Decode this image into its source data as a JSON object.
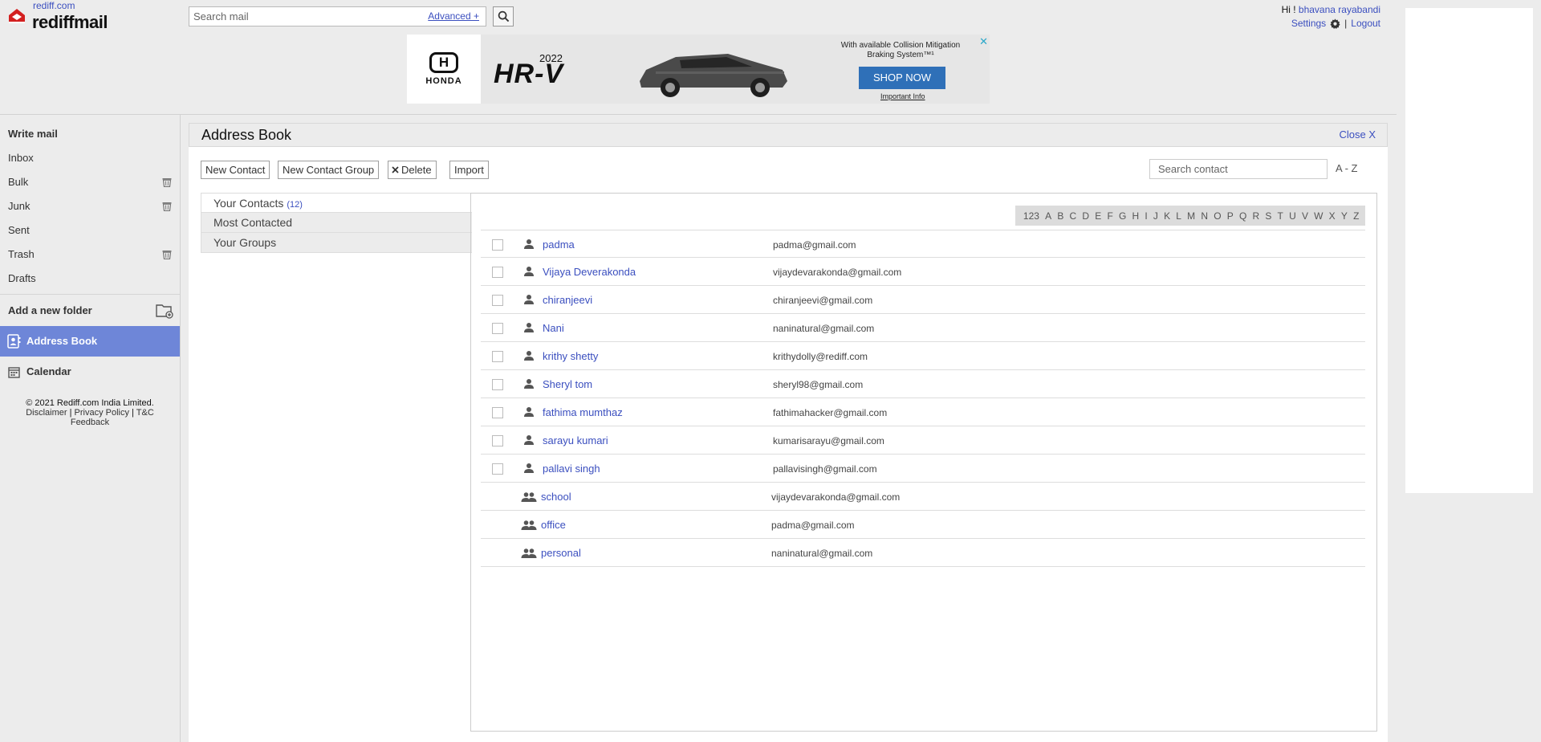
{
  "header": {
    "logo_small": "rediff.com",
    "logo_big": "rediffmail",
    "search_placeholder": "Search mail",
    "advanced_label": "Advanced +",
    "greeting": "Hi !",
    "user_name": "bhavana rayabandi",
    "settings_label": "Settings",
    "separator": "|",
    "logout_label": "Logout"
  },
  "ad": {
    "brand": "HONDA",
    "brand_mark": "H",
    "year": "2022",
    "model": "HR-V",
    "blurb": "With available Collision Mitigation Braking System™¹",
    "cta": "SHOP NOW",
    "info": "Important Info",
    "close": "✕"
  },
  "sidebar": {
    "write_mail": "Write mail",
    "folders": [
      {
        "label": "Inbox",
        "trash": false
      },
      {
        "label": "Bulk",
        "trash": true
      },
      {
        "label": "Junk",
        "trash": true
      },
      {
        "label": "Sent",
        "trash": false
      },
      {
        "label": "Trash",
        "trash": true
      },
      {
        "label": "Drafts",
        "trash": false
      }
    ],
    "add_folder": "Add a new folder",
    "address_book": "Address Book",
    "calendar": "Calendar",
    "footer": {
      "copyright": "© 2021 Rediff.com India Limited.",
      "disclaimer": "Disclaimer",
      "privacy": "Privacy Policy",
      "tc": "T&C",
      "feedback": "Feedback",
      "sep": "|"
    }
  },
  "main": {
    "title": "Address Book",
    "close_label": "Close X",
    "toolbar": {
      "new_contact": "New Contact",
      "new_group": "New Contact Group",
      "delete": "Delete",
      "import": "Import"
    },
    "search_placeholder": "Search contact",
    "sort_label": "A - Z",
    "left_tabs": {
      "your_contacts": "Your Contacts",
      "contacts_count": "(12)",
      "most_contacted": "Most Contacted",
      "your_groups": "Your Groups"
    },
    "alphabet": [
      "123",
      "A",
      "B",
      "C",
      "D",
      "E",
      "F",
      "G",
      "H",
      "I",
      "J",
      "K",
      "L",
      "M",
      "N",
      "O",
      "P",
      "Q",
      "R",
      "S",
      "T",
      "U",
      "V",
      "W",
      "X",
      "Y",
      "Z"
    ],
    "contacts": [
      {
        "name": "padma",
        "email": "padma@gmail.com"
      },
      {
        "name": "Vijaya Deverakonda",
        "email": "vijaydevarakonda@gmail.com"
      },
      {
        "name": "chiranjeevi",
        "email": "chiranjeevi@gmail.com"
      },
      {
        "name": "Nani",
        "email": "naninatural@gmail.com"
      },
      {
        "name": "krithy shetty",
        "email": "krithydolly@rediff.com"
      },
      {
        "name": "Sheryl tom",
        "email": "sheryl98@gmail.com"
      },
      {
        "name": "fathima mumthaz",
        "email": "fathimahacker@gmail.com"
      },
      {
        "name": "sarayu kumari",
        "email": "kumarisarayu@gmail.com"
      },
      {
        "name": "pallavi singh",
        "email": "pallavisingh@gmail.com"
      }
    ],
    "groups": [
      {
        "name": "school",
        "email": "vijaydevarakonda@gmail.com"
      },
      {
        "name": "office",
        "email": "padma@gmail.com"
      },
      {
        "name": "personal",
        "email": "naninatural@gmail.com"
      }
    ]
  }
}
